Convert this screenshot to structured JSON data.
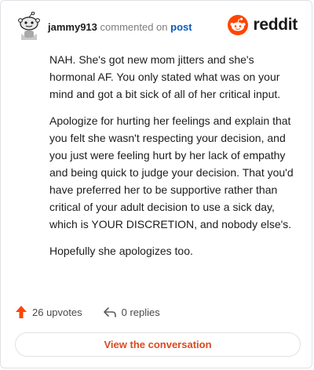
{
  "header": {
    "username": "jammy913",
    "action_text": "commented on",
    "post_link": "post",
    "brand_name": "reddit",
    "brand_color": "#ff4500"
  },
  "comment": {
    "paragraphs": [
      "NAH. She's got new mom jitters and she's hormonal AF. You only stated what was on your mind and got a bit sick of all of her critical input.",
      "Apologize for hurting her feelings and explain that you felt she wasn't respecting your decision, and you just were feeling hurt by her lack of empathy and being quick to judge your decision. That you'd have preferred her to be supportive rather than critical of your adult decision to use a sick day, which is YOUR DISCRETION, and nobody else's.",
      "Hopefully she apologizes too."
    ]
  },
  "stats": {
    "upvotes": "26 upvotes",
    "replies": "0 replies",
    "upvote_icon": "upvote-arrow-icon",
    "reply_icon": "reply-arrow-icon",
    "upvote_color": "#ff4500"
  },
  "cta": {
    "label": "View the conversation",
    "color": "#d94a1e"
  }
}
